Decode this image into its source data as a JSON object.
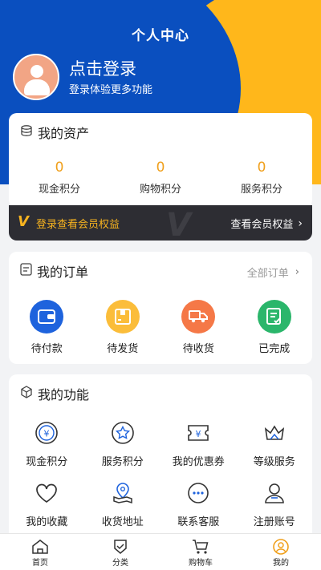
{
  "header": {
    "title": "个人中心"
  },
  "user": {
    "login_title": "点击登录",
    "login_subtitle": "登录体验更多功能"
  },
  "assets": {
    "title": "我的资产",
    "items": [
      {
        "value": "0",
        "label": "现金积分"
      },
      {
        "value": "0",
        "label": "购物积分"
      },
      {
        "value": "0",
        "label": "服务积分"
      }
    ]
  },
  "vip": {
    "left_text": "登录查看会员权益",
    "right_text": "查看会员权益"
  },
  "orders": {
    "title": "我的订单",
    "all_text": "全部订单",
    "items": [
      {
        "label": "待付款",
        "color": "#1e63dd",
        "icon": "wallet-icon"
      },
      {
        "label": "待发货",
        "color": "#fbbd3a",
        "icon": "package-icon"
      },
      {
        "label": "待收货",
        "color": "#f57847",
        "icon": "truck-icon"
      },
      {
        "label": "已完成",
        "color": "#2bb66b",
        "icon": "check-doc-icon"
      }
    ]
  },
  "functions": {
    "title": "我的功能",
    "items": [
      {
        "label": "现金积分",
        "icon": "yuan-circle-icon"
      },
      {
        "label": "服务积分",
        "icon": "star-badge-icon"
      },
      {
        "label": "我的优惠券",
        "icon": "coupon-icon"
      },
      {
        "label": "等级服务",
        "icon": "crown-icon"
      },
      {
        "label": "我的收藏",
        "icon": "heart-icon"
      },
      {
        "label": "收货地址",
        "icon": "location-map-icon"
      },
      {
        "label": "联系客服",
        "icon": "headset-icon"
      },
      {
        "label": "注册账号",
        "icon": "user-icon"
      }
    ]
  },
  "tabbar": {
    "items": [
      {
        "label": "首页",
        "icon": "home-icon"
      },
      {
        "label": "分类",
        "icon": "category-icon"
      },
      {
        "label": "购物车",
        "icon": "cart-icon"
      },
      {
        "label": "我的",
        "icon": "profile-icon",
        "active": true
      }
    ]
  },
  "colors": {
    "brand_blue": "#0a4fbf",
    "accent_yellow": "#ffb71b",
    "points_orange": "#f0a01c"
  }
}
